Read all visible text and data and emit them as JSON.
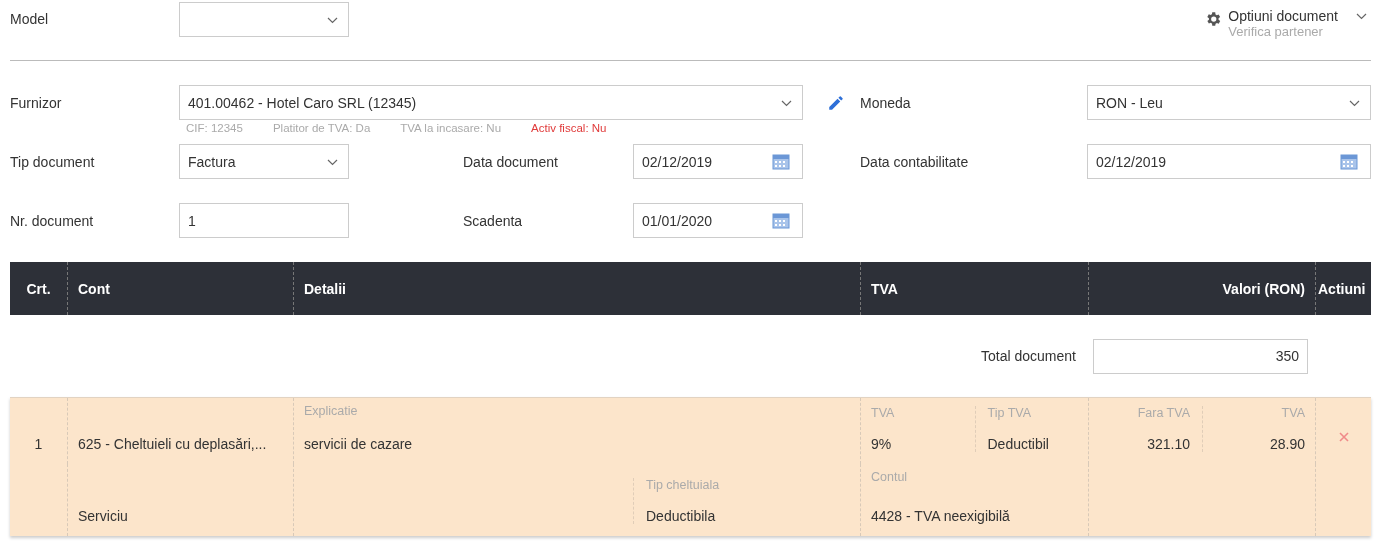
{
  "model": {
    "label": "Model"
  },
  "options": {
    "title": "Optiuni document",
    "subtitle": "Verifica partener"
  },
  "furnizor": {
    "label": "Furnizor",
    "value": "401.00462 - Hotel Caro SRL (12345)",
    "info": [
      {
        "text": "CIF: 12345",
        "warning": false
      },
      {
        "text": "Platitor de TVA: Da",
        "warning": false
      },
      {
        "text": "TVA la incasare: Nu",
        "warning": false
      },
      {
        "text": "Activ fiscal: Nu",
        "warning": true
      }
    ]
  },
  "moneda": {
    "label": "Moneda",
    "value": "RON - Leu"
  },
  "tip_document": {
    "label": "Tip document",
    "value": "Factura"
  },
  "data_document": {
    "label": "Data document",
    "value": "02/12/2019"
  },
  "data_contabilitate": {
    "label": "Data contabilitate",
    "value": "02/12/2019"
  },
  "nr_document": {
    "label": "Nr. document",
    "value": "1"
  },
  "scadenta": {
    "label": "Scadenta",
    "value": "01/01/2020"
  },
  "table": {
    "columns": [
      "Crt.",
      "Cont",
      "Detalii",
      "TVA",
      "Valori (RON)",
      "Actiuni"
    ],
    "total": {
      "label": "Total document",
      "value": "350"
    },
    "rows": [
      {
        "crt": "1",
        "cont": "625 - Cheltuieli cu deplasări,...",
        "tip": "Serviciu",
        "explicatie_label": "Explicatie",
        "explicatie": "servicii de cazare",
        "tva_label": "TVA",
        "tva": "9%",
        "tip_tva_label": "Tip TVA",
        "tip_tva": "Deductibil",
        "fara_tva_label": "Fara TVA",
        "fara_tva": "321.10",
        "tva_valoare_label": "TVA",
        "tva_valoare": "28.90",
        "tip_cheltuiala_label": "Tip cheltuiala",
        "tip_cheltuiala": "Deductibila",
        "contul_label": "Contul",
        "contul": "4428 - TVA neexigibilă"
      }
    ]
  }
}
